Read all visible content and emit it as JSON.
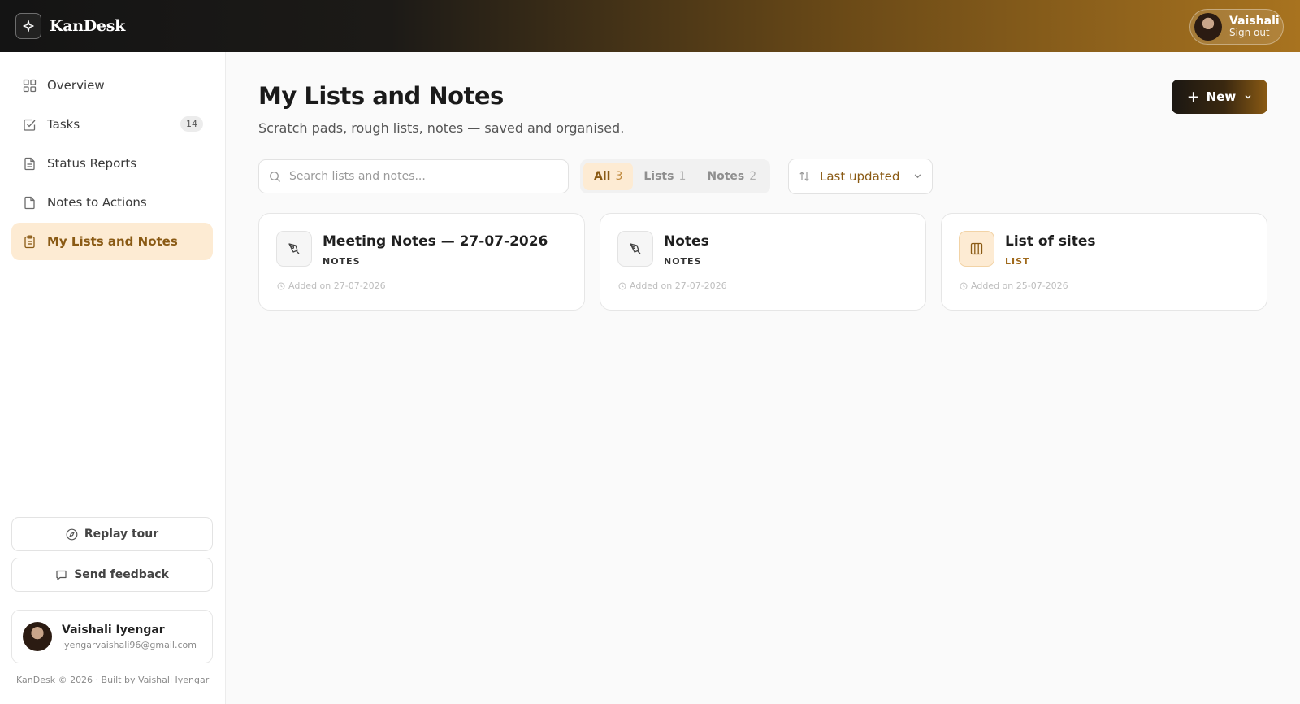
{
  "app": {
    "name": "KanDesk",
    "accent_color": "#8a5a14",
    "accent_light": "#fdebd3"
  },
  "topbar": {
    "user_name": "Vaishali",
    "sign_out_label": "Sign out"
  },
  "sidebar": {
    "items": [
      {
        "label": "Overview",
        "icon": "grid-icon"
      },
      {
        "label": "Tasks",
        "icon": "checkbox-icon",
        "badge": "14"
      },
      {
        "label": "Status Reports",
        "icon": "document-icon"
      },
      {
        "label": "Notes to Actions",
        "icon": "file-icon"
      },
      {
        "label": "My Lists and Notes",
        "icon": "clipboard-icon",
        "active": true
      }
    ],
    "replay_tour_label": "Replay tour",
    "send_feedback_label": "Send feedback",
    "profile": {
      "name": "Vaishali Iyengar",
      "email": "iyengarvaishali96@gmail.com"
    },
    "footer": "KanDesk © 2026 · Built by Vaishali Iyengar"
  },
  "main": {
    "title": "My Lists and Notes",
    "subtitle": "Scratch pads, rough lists, notes — saved and organised.",
    "new_button_label": "New",
    "search": {
      "placeholder": "Search lists and notes...",
      "value": ""
    },
    "filters": [
      {
        "label": "All",
        "count": "3",
        "active": true
      },
      {
        "label": "Lists",
        "count": "1"
      },
      {
        "label": "Notes",
        "count": "2"
      }
    ],
    "sort_label": "Last updated",
    "cards": [
      {
        "title": "Meeting Notes — 27-07-2026",
        "type": "NOTES",
        "date": "Added on 27-07-2026",
        "icon": "pen-tool-icon"
      },
      {
        "title": "Notes",
        "type": "NOTES",
        "date": "Added on 27-07-2026",
        "icon": "pen-tool-icon"
      },
      {
        "title": "List of sites",
        "type": "LIST",
        "date": "Added on 25-07-2026",
        "icon": "columns-icon"
      }
    ]
  }
}
